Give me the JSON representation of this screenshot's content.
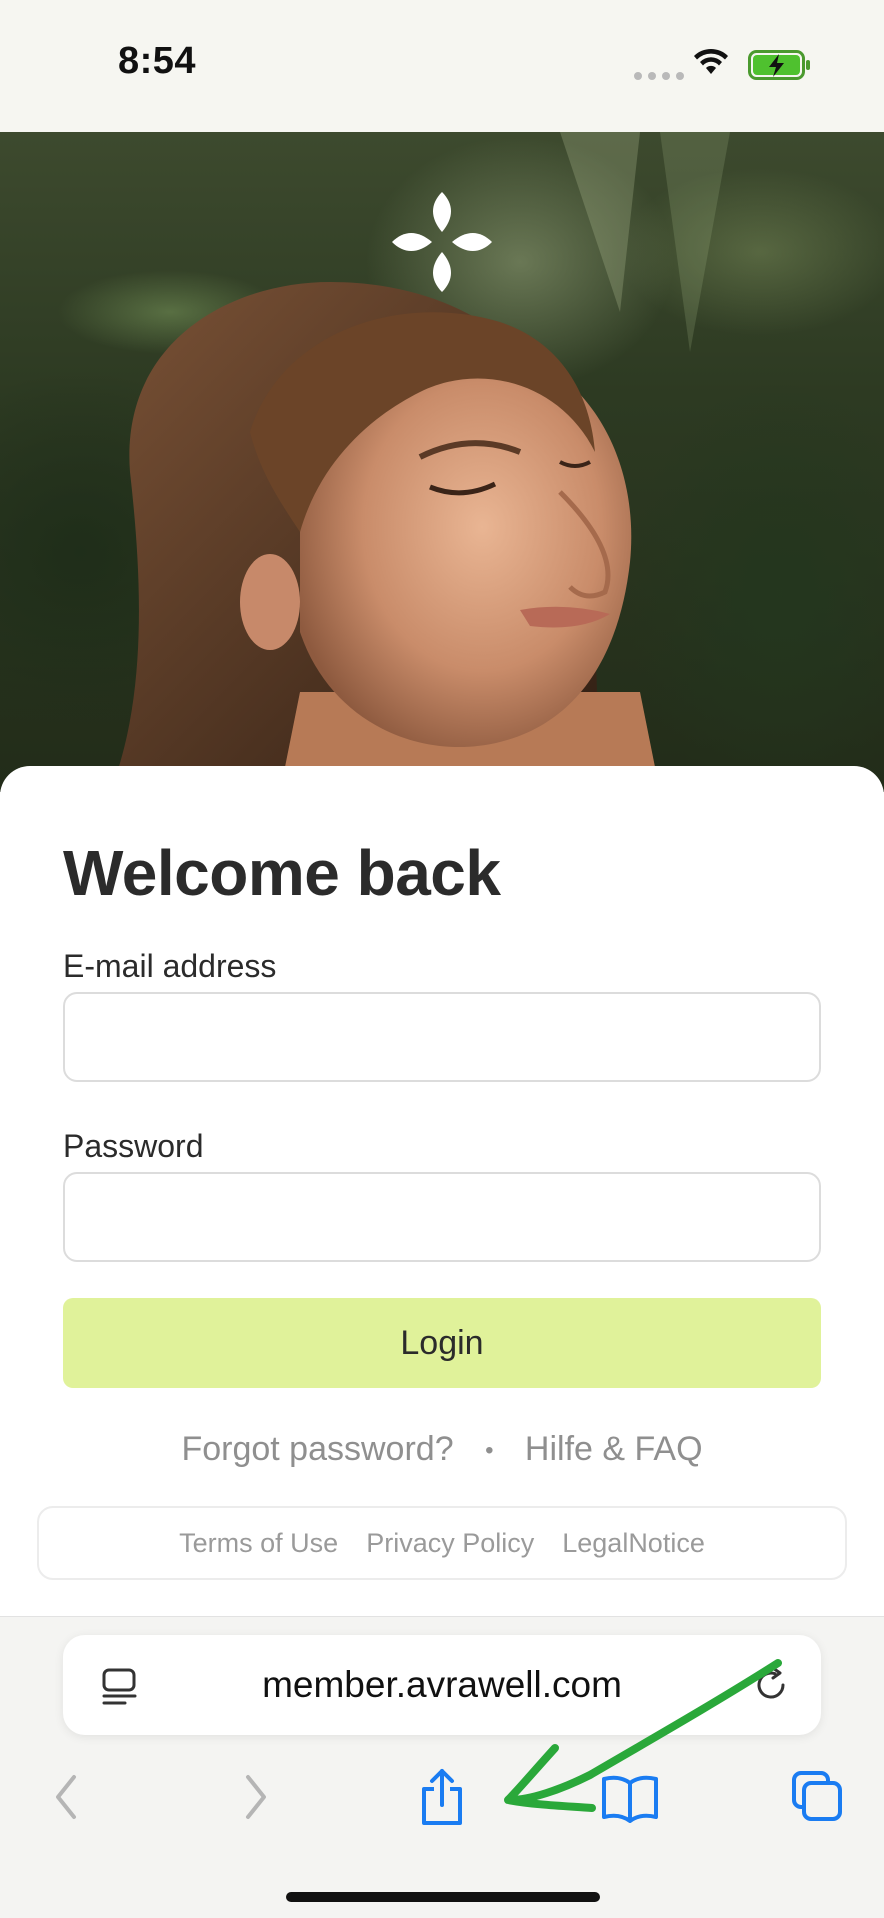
{
  "status_bar": {
    "time": "8:54"
  },
  "form": {
    "title": "Welcome back",
    "email_label": "E-mail address",
    "email_value": "",
    "password_label": "Password",
    "password_value": "",
    "login_label": "Login",
    "forgot_label": "Forgot password?",
    "separator": "•",
    "help_label": "Hilfe & FAQ"
  },
  "footer_links": [
    "Terms of Use",
    "Privacy Policy",
    "LegalNotice"
  ],
  "browser": {
    "url": "member.avrawell.com",
    "icons": [
      "reader-icon",
      "reload-icon",
      "back-icon",
      "forward-icon",
      "share-icon",
      "bookmarks-icon",
      "tabs-icon"
    ]
  },
  "colors": {
    "login_button": "#e0f29a",
    "accent_blue": "#1a7cf2",
    "annotation_green": "#2aa83a"
  }
}
